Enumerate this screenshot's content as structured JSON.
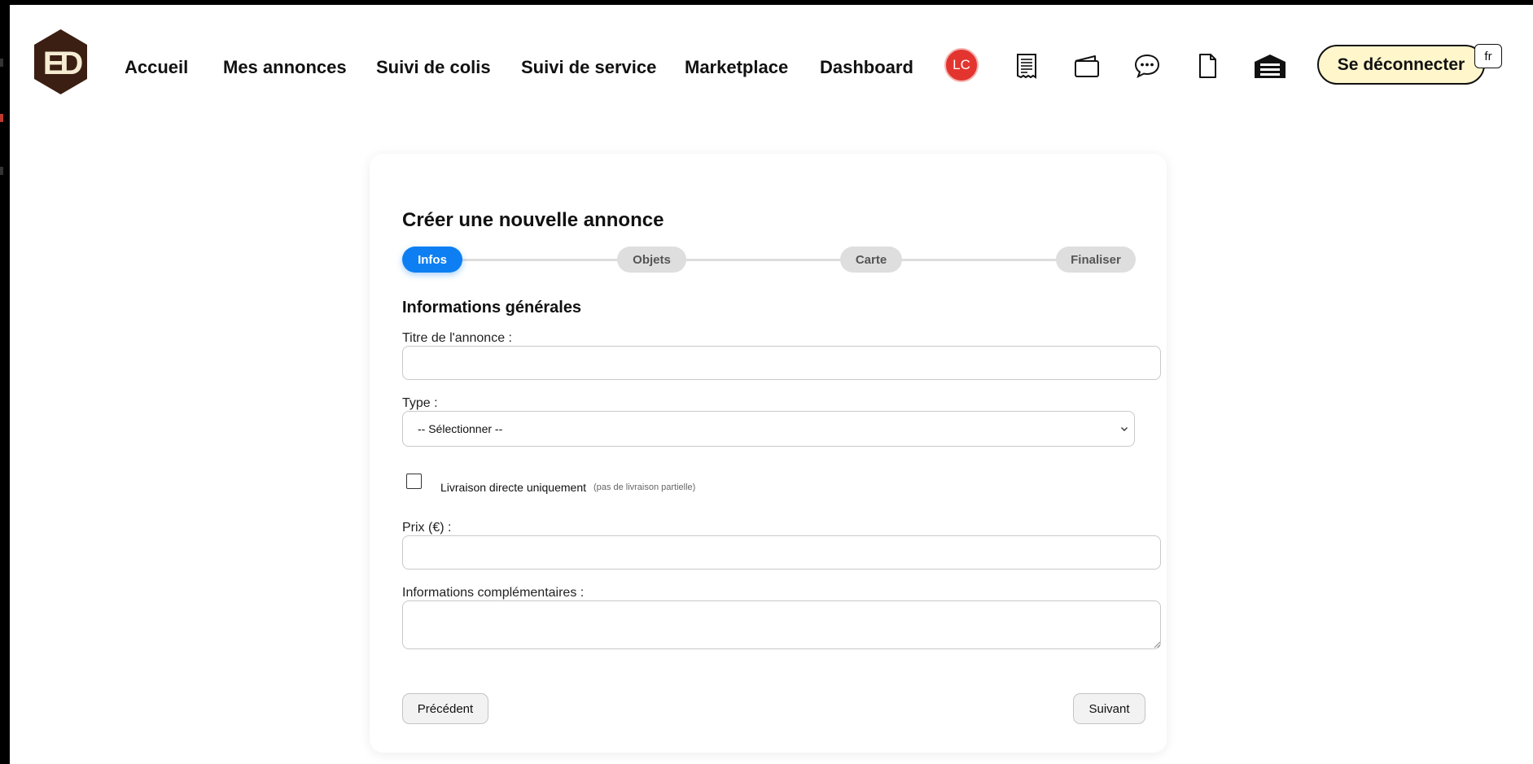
{
  "nav": {
    "links": [
      {
        "label": "Accueil"
      },
      {
        "label": "Mes annonces"
      },
      {
        "label": "Suivi de colis"
      },
      {
        "label": "Suivi de service"
      },
      {
        "label": "Marketplace"
      },
      {
        "label": "Dashboard"
      }
    ],
    "avatar_initials": "LC",
    "icons": [
      "receipt-icon",
      "wallet-icon",
      "chat-icon",
      "document-icon",
      "warehouse-icon"
    ],
    "logout_label": "Se déconnecter",
    "language": "fr"
  },
  "form": {
    "title": "Créer une nouvelle annonce",
    "steps": [
      {
        "label": "Infos",
        "active": true
      },
      {
        "label": "Objets",
        "active": false
      },
      {
        "label": "Carte",
        "active": false
      },
      {
        "label": "Finaliser",
        "active": false
      }
    ],
    "section_title": "Informations générales",
    "title_label": "Titre de l'annonce :",
    "title_value": "",
    "type_label": "Type :",
    "type_selected": "-- Sélectionner --",
    "direct_delivery_label": "Livraison directe uniquement",
    "direct_delivery_hint": "(pas de livraison partielle)",
    "direct_delivery_checked": false,
    "price_label": "Prix (€) :",
    "price_value": "",
    "extra_info_label": "Informations complémentaires :",
    "extra_info_value": "",
    "prev_label": "Précédent",
    "next_label": "Suivant"
  },
  "colors": {
    "accent": "#0d7ff2",
    "avatar": "#e3342f",
    "logo": "#3b1f12",
    "logout_bg": "#fff6cc"
  }
}
